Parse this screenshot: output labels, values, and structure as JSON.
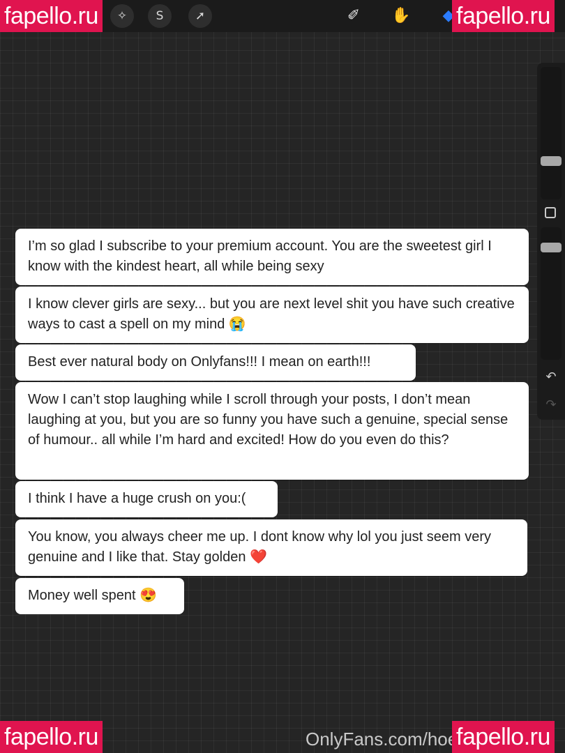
{
  "toolbar": {
    "left_tools": [
      {
        "name": "magic-wand-icon",
        "glyph": "✧"
      },
      {
        "name": "selection-icon",
        "glyph": "S"
      },
      {
        "name": "transform-arrow-icon",
        "glyph": "➚"
      }
    ],
    "right_tools": [
      {
        "name": "brush-icon",
        "glyph": "✐"
      },
      {
        "name": "smudge-icon",
        "glyph": "✋"
      },
      {
        "name": "eraser-icon",
        "glyph": "◆",
        "color": "#2b7cff"
      }
    ]
  },
  "watermark": {
    "text": "fapello.ru",
    "color": "#e0144f"
  },
  "sidebar": {
    "undo_glyph": "↶",
    "redo_glyph": "↷"
  },
  "messages": [
    {
      "text": "I’m so glad I subscribe to your premium account. You are the sweetest girl I know with the kindest heart, all while being sexy"
    },
    {
      "text": "I know clever girls are sexy... but you are next level shit you have such creative ways to cast a spell on my mind 😭"
    },
    {
      "text": "Best ever natural body on Onlyfans!!! I mean on earth!!!"
    },
    {
      "text": "Wow I can’t stop laughing while I scroll through your posts, I don’t mean laughing at you, but you are so funny you have such a genuine, special sense of humour.. all while I’m hard and excited! How do you even do this?"
    },
    {
      "text": "I think I have a huge crush on you:("
    },
    {
      "text": "You know, you always cheer me up. I dont know why lol you just seem very genuine and I like that. Stay golden ❤️"
    },
    {
      "text": "Money well spent 😍"
    }
  ],
  "footer": {
    "url_text": "OnlyFans.com/hoe"
  }
}
